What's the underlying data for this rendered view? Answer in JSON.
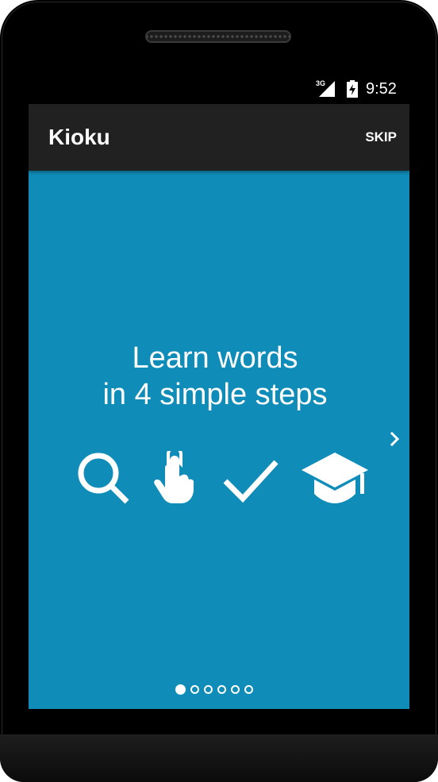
{
  "status_bar": {
    "network_label": "3G",
    "time": "9:52"
  },
  "app_bar": {
    "title": "Kioku",
    "skip_label": "SKIP"
  },
  "intro": {
    "headline_line1": "Learn words",
    "headline_line2": "in 4 simple steps"
  },
  "step_icons": [
    "search-icon",
    "touch-icon",
    "check-icon",
    "graduation-cap-icon"
  ],
  "pager": {
    "page_count": 6,
    "current_page": 1
  },
  "colors": {
    "screen_background": "#0f8cb8",
    "app_bar_background": "#212121",
    "foreground": "#ffffff"
  }
}
